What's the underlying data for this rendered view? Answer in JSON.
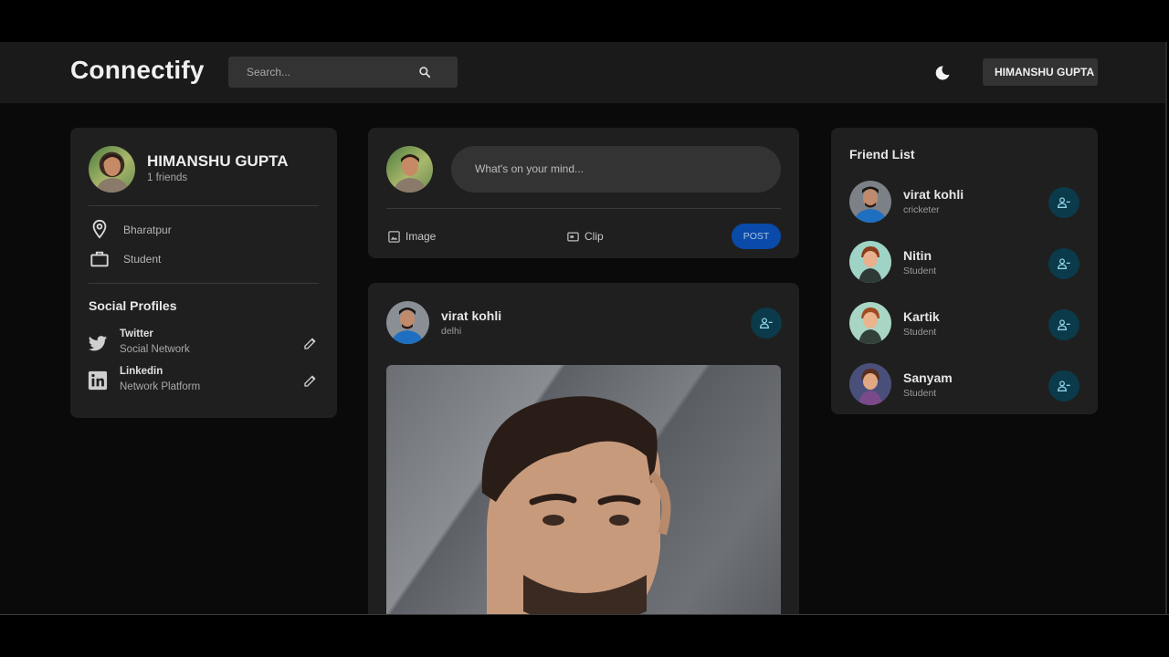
{
  "app": {
    "logo": "Connectify"
  },
  "search": {
    "placeholder": "Search..."
  },
  "header": {
    "user_button": "HIMANSHU GUPTA"
  },
  "profile": {
    "name": "HIMANSHU GUPTA",
    "friends": "1 friends",
    "location": "Bharatpur",
    "occupation": "Student",
    "social_title": "Social Profiles",
    "socials": [
      {
        "name": "Twitter",
        "type": "Social Network",
        "icon": "twitter-icon"
      },
      {
        "name": "Linkedin",
        "type": "Network Platform",
        "icon": "linkedin-icon"
      }
    ]
  },
  "composer": {
    "placeholder": "What's on your mind...",
    "image_label": "Image",
    "clip_label": "Clip",
    "post_label": "POST"
  },
  "post": {
    "author": "virat kohli",
    "location": "delhi"
  },
  "friend_list": {
    "title": "Friend List",
    "friends": [
      {
        "name": "virat kohli",
        "role": "cricketer"
      },
      {
        "name": "Nitin",
        "role": "Student"
      },
      {
        "name": "Kartik",
        "role": "Student"
      },
      {
        "name": "Sanyam",
        "role": "Student"
      }
    ]
  },
  "colors": {
    "accent": "#0a4aa8",
    "icon_button_bg": "#0b3a4a",
    "icon_button_fg": "#8fd3e6",
    "card": "#1f1f1f",
    "navbar": "#1a1a1a"
  }
}
